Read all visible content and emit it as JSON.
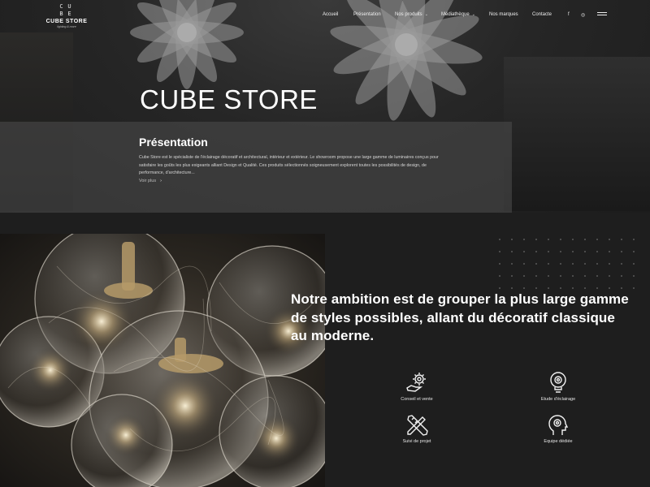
{
  "brand": {
    "cube_letters": [
      "C",
      "U",
      "B",
      "E"
    ],
    "name": "CUBE STORE",
    "tagline": "lighting & more"
  },
  "nav": {
    "items": [
      {
        "label": "Accueil",
        "has_dropdown": false
      },
      {
        "label": "Présentation",
        "has_dropdown": false
      },
      {
        "label": "Nos produits",
        "has_dropdown": true
      },
      {
        "label": "Médiathèque",
        "has_dropdown": true
      },
      {
        "label": "Nos marques",
        "has_dropdown": false
      },
      {
        "label": "Contacte",
        "has_dropdown": false
      }
    ],
    "social": [
      "facebook-icon",
      "instagram-icon"
    ],
    "menu_icon": "hamburger-icon"
  },
  "hero": {
    "title": "CUBE STORE"
  },
  "presentation": {
    "title": "Présentation",
    "text": "Cube Store est le spécialiste de l'éclairage décoratif et architectural, intérieur et extérieur. Le showroom propose une large gamme de luminaires conçus pour satisfaire les goûts les plus exigeants alliant Design et Qualité. Ces produits sélectionnés soigneusement explorent toutes les possibilités de design, de performance, d'architecture...",
    "more_label": "Voir plus",
    "more_arrow": "›"
  },
  "ambition": {
    "text": "Notre ambition est de grouper la plus large gamme de styles possibles, allant du décoratif classique au moderne."
  },
  "features": [
    {
      "label": "Conseil et vente",
      "icon": "hand-gear-icon"
    },
    {
      "label": "Etude d'éclairage",
      "icon": "bulb-gear-icon"
    },
    {
      "label": "Suivi de projet",
      "icon": "pencil-ruler-icon"
    },
    {
      "label": "Equipe dédiée",
      "icon": "head-gear-icon"
    }
  ],
  "colors": {
    "background": "#1d1d1d",
    "overlay": "#484848",
    "text": "#ffffff"
  }
}
